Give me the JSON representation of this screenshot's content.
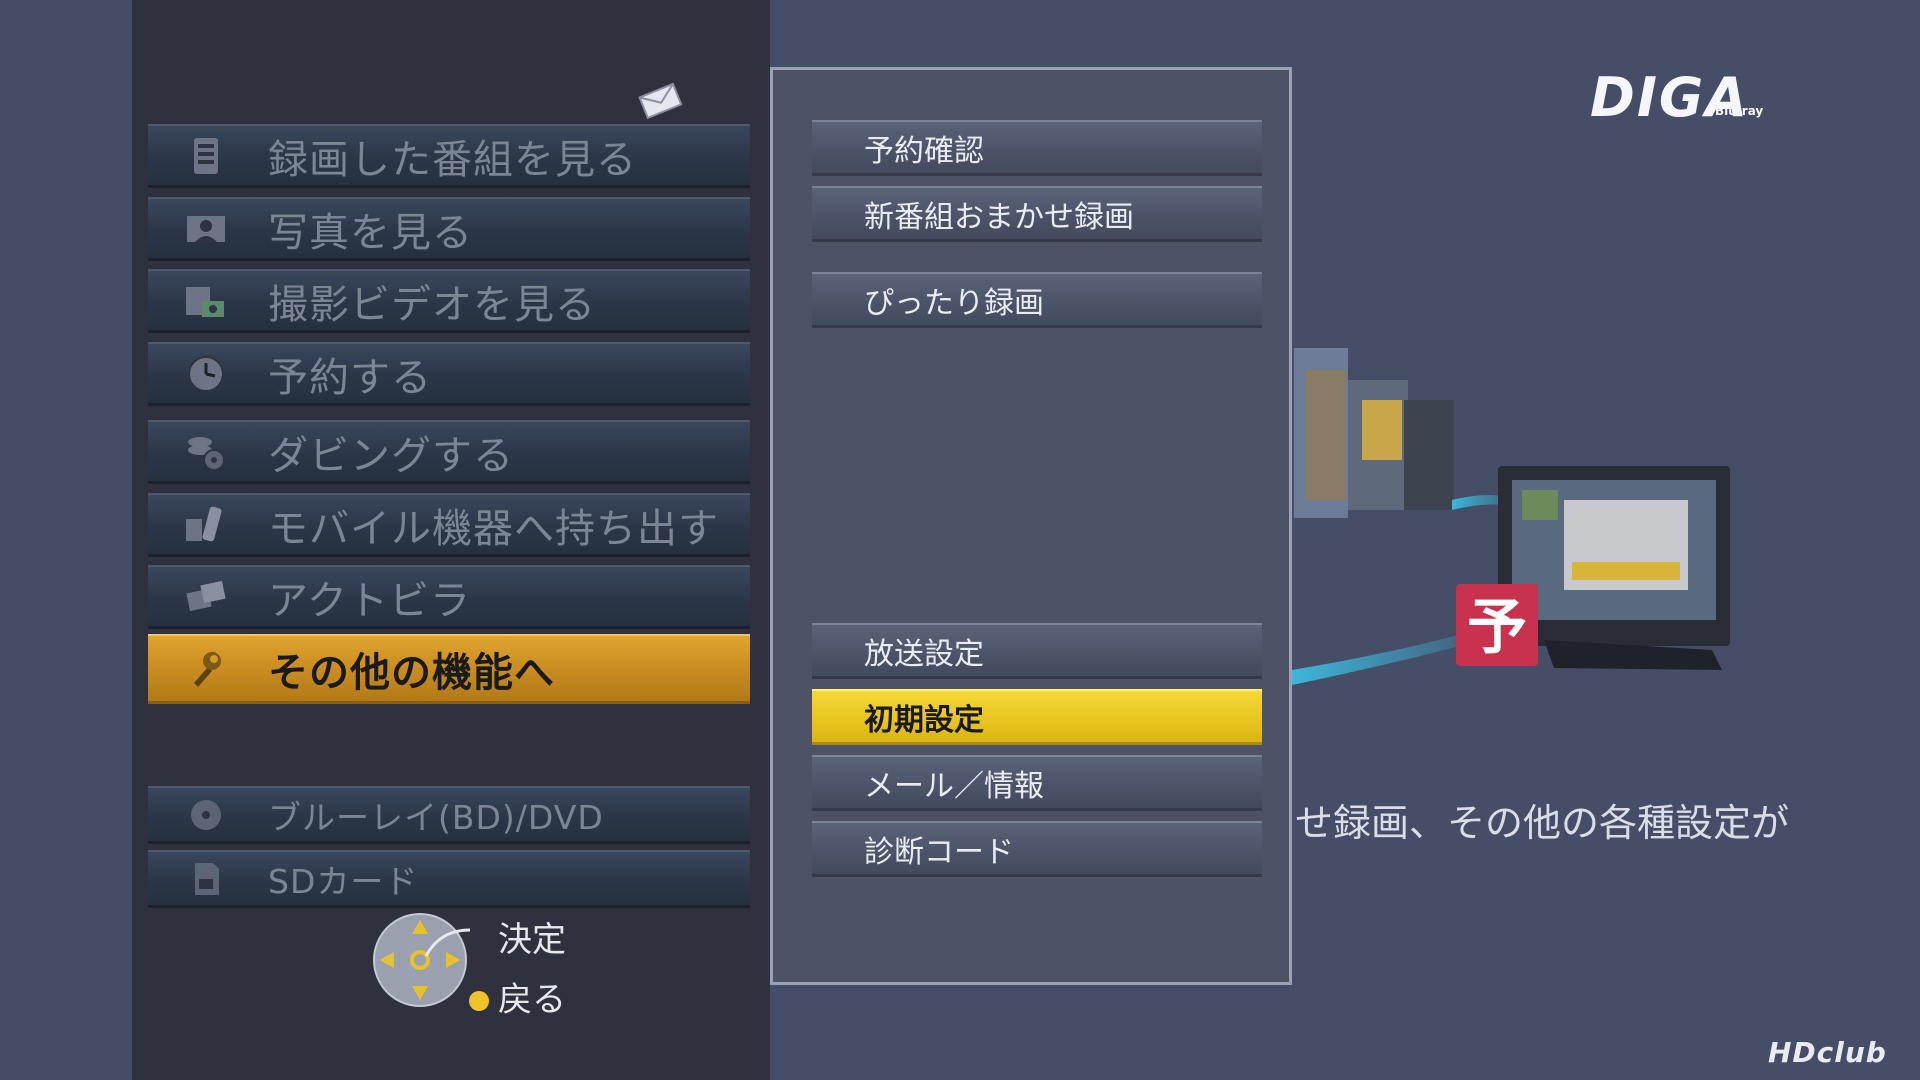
{
  "main_menu": {
    "items": [
      {
        "label": "録画した番組を見る",
        "icon": "recording-icon"
      },
      {
        "label": "写真を見る",
        "icon": "photo-icon"
      },
      {
        "label": "撮影ビデオを見る",
        "icon": "video-camera-icon"
      },
      {
        "label": "予約する",
        "icon": "clock-icon"
      },
      {
        "label": "ダビングする",
        "icon": "dubbing-icon"
      },
      {
        "label": "モバイル機器へ持ち出す",
        "icon": "mobile-device-icon"
      },
      {
        "label": "アクトビラ",
        "icon": "actvila-icon"
      },
      {
        "label": "その他の機能へ",
        "icon": "tools-icon",
        "selected": true
      }
    ],
    "media_items": [
      {
        "label": "ブルーレイ(BD)/DVD",
        "icon": "disc-icon"
      },
      {
        "label": "SDカード",
        "icon": "sd-card-icon"
      }
    ]
  },
  "sub_menu": {
    "items": [
      {
        "label": "予約確認"
      },
      {
        "label": "新番組おまかせ録画"
      },
      {
        "label": "ぴったり録画"
      },
      {
        "label": "放送設定"
      },
      {
        "label": "初期設定",
        "selected": true
      },
      {
        "label": "メール／情報"
      },
      {
        "label": "診断コード"
      }
    ]
  },
  "controls": {
    "enter_label": "決定",
    "back_label": "戻る"
  },
  "description": "せ録画、その他の各種設定が",
  "logo": {
    "text": "DIGA",
    "sub": "Blu-ray"
  },
  "watermark": "HDclub",
  "colors": {
    "selected_main": "#d29a2a",
    "selected_sub": "#f0d12e",
    "panel_bg": "#30313f",
    "background": "#464d67"
  }
}
